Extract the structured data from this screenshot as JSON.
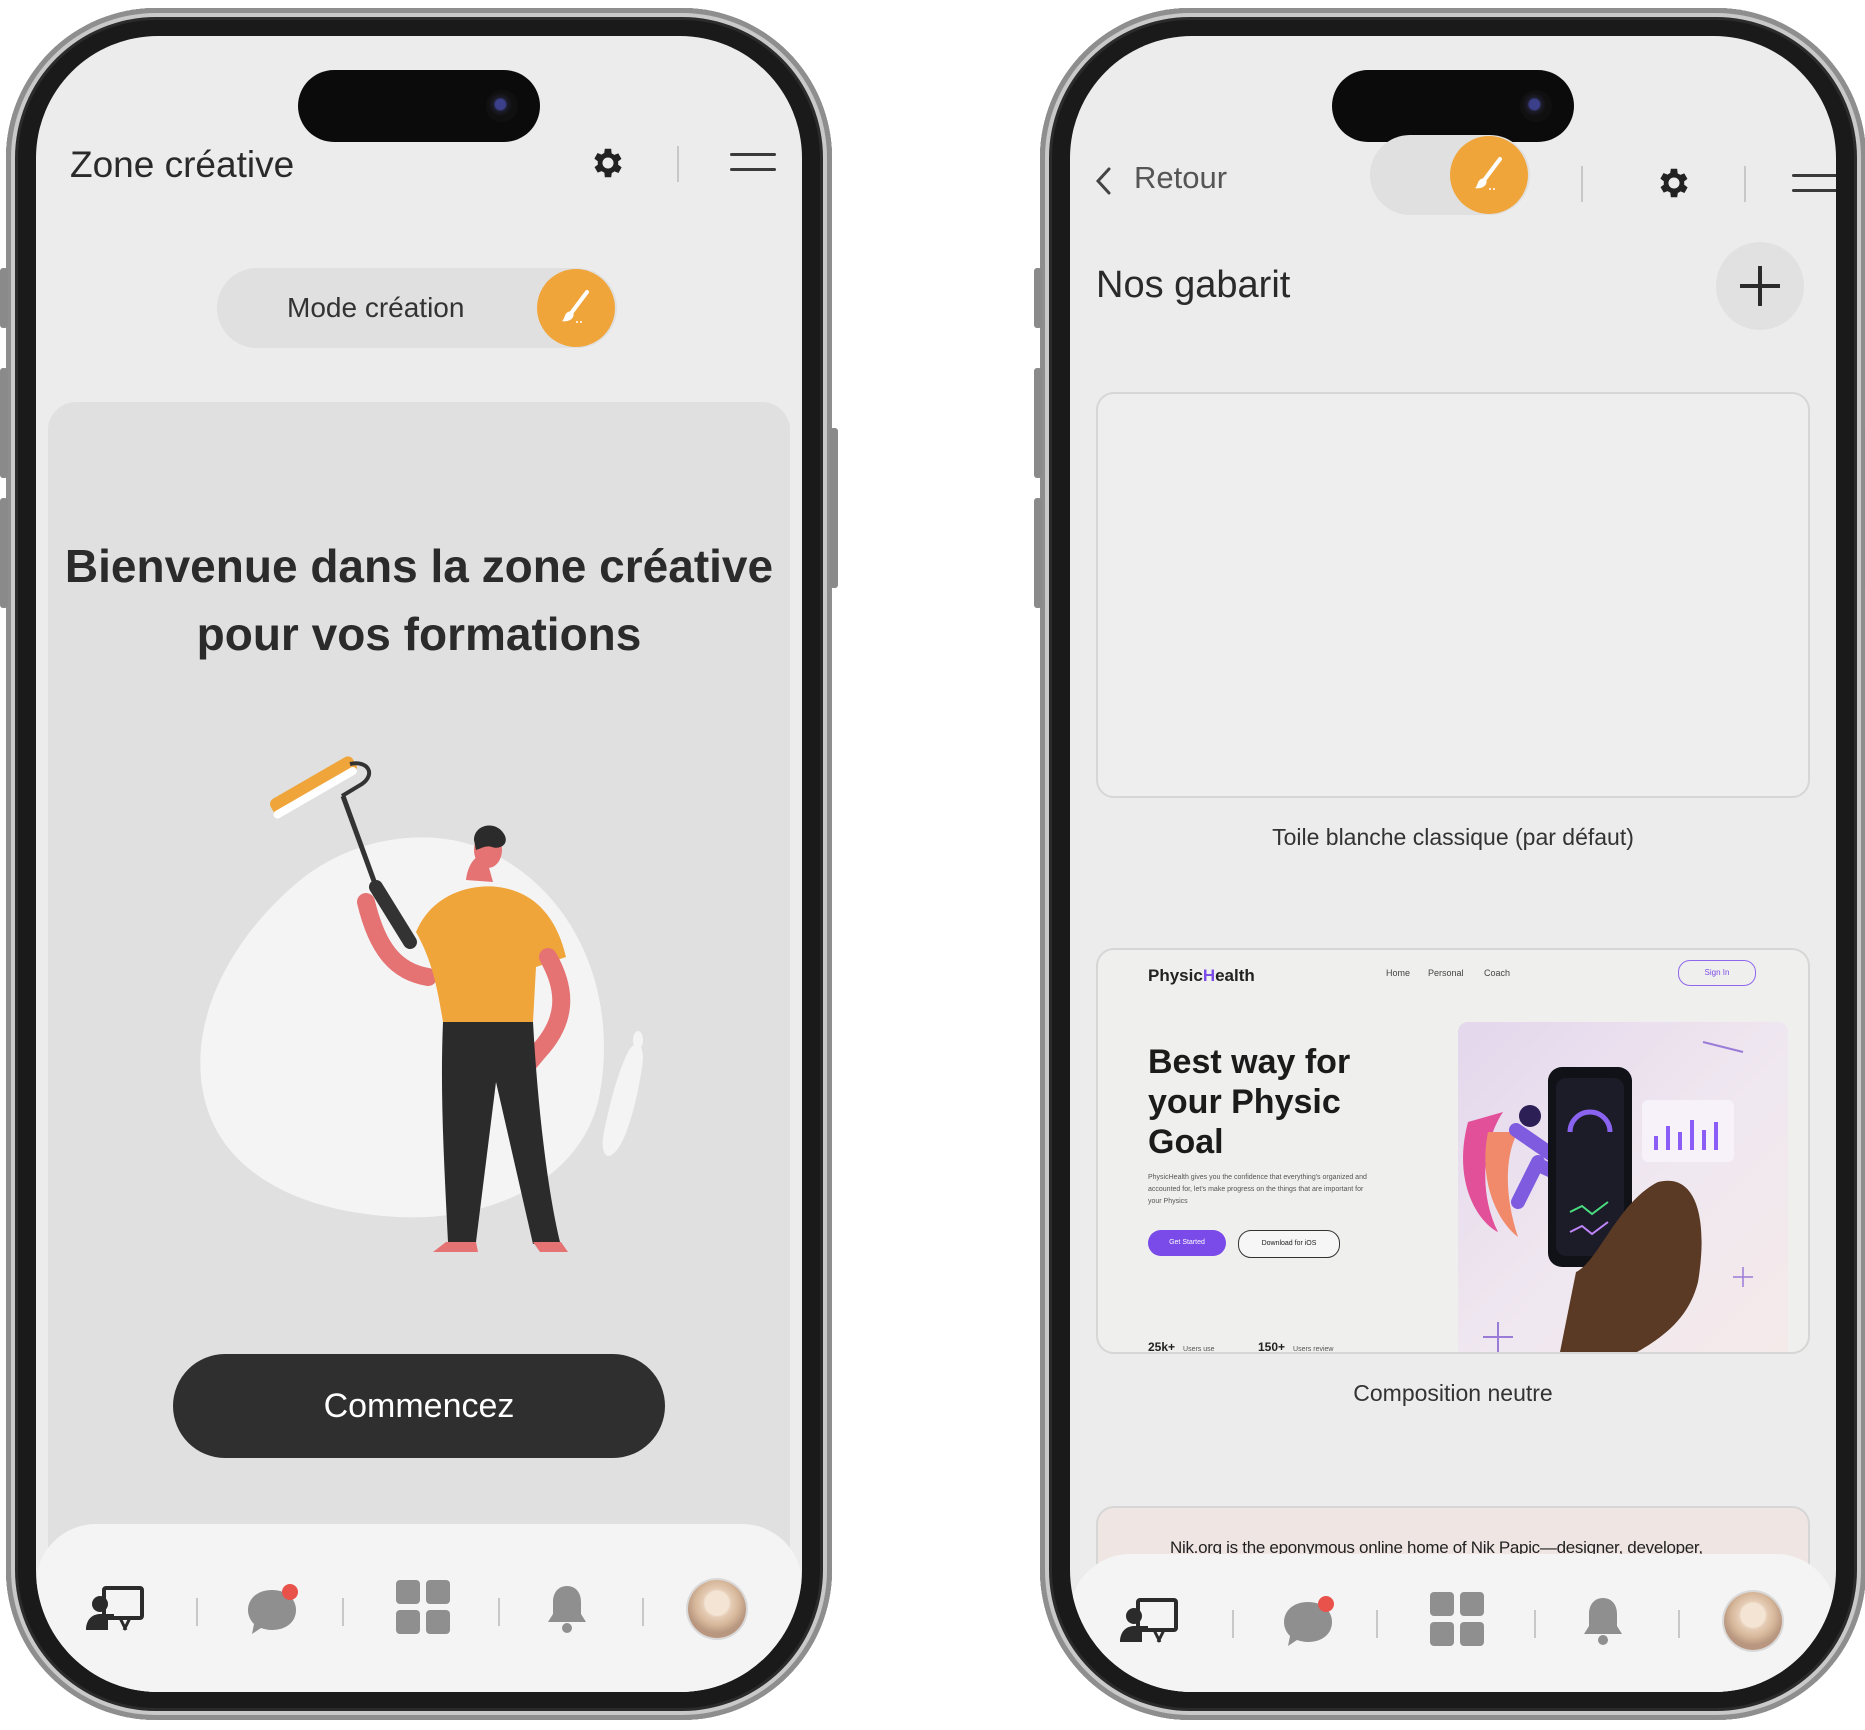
{
  "left": {
    "header": {
      "title": "Zone créative"
    },
    "mode_toggle": {
      "label": "Mode création"
    },
    "hero": {
      "title_line1": "Bienvenue dans la zone créative",
      "title_line2": "pour vos formations"
    },
    "cta": {
      "label": "Commencez"
    },
    "nav": {
      "icons": [
        "training-icon",
        "chat-icon",
        "dashboard-icon",
        "bell-icon",
        "avatar"
      ],
      "chat_badge": true
    }
  },
  "right": {
    "header": {
      "back_label": "Retour"
    },
    "section": {
      "title": "Nos gabarit"
    },
    "templates": [
      {
        "caption": "Toile blanche classique (par défaut)"
      },
      {
        "caption": "Composition neutre",
        "preview": {
          "logo_a": "Physic",
          "logo_b": "H",
          "logo_c": "ealth",
          "nav": [
            "Home",
            "Personal",
            "Coach"
          ],
          "signin": "Sign In",
          "headline": "Best way for your Physic Goal",
          "description": "PhysicHealth gives you the confidence that everything's organized and accounted for, let's make progress on the things that are important for your Physics",
          "btn_primary": "Get Started",
          "btn_secondary": "Download for iOS",
          "stat1": "25k+",
          "stat1_label": "Users use",
          "stat2": "150+",
          "stat2_label": "Users review"
        }
      },
      {
        "preview_text": "Nik.org is the eponymous online home of Nik Papic—designer, developer, marketer, perpetual entrepreneur,"
      }
    ],
    "nav": {
      "icons": [
        "training-icon",
        "chat-icon",
        "dashboard-icon",
        "bell-icon",
        "avatar"
      ],
      "chat_badge": true
    }
  },
  "colors": {
    "accent": "#f0a53a",
    "dark": "#2f2f2f",
    "badge": "#e8524a",
    "screen_bg": "#ececec"
  }
}
